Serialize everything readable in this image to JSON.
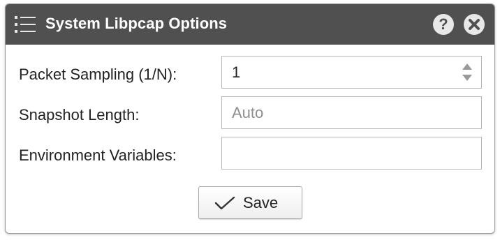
{
  "dialog": {
    "title": "System Libpcap Options",
    "title_icon": "list-icon",
    "help_icon": "help-icon",
    "close_icon": "close-icon",
    "help_glyph": "?"
  },
  "form": {
    "packet_sampling": {
      "label": "Packet Sampling (1/N):",
      "value": "1"
    },
    "snapshot_length": {
      "label": "Snapshot Length:",
      "value": "",
      "placeholder": "Auto"
    },
    "environment_variables": {
      "label": "Environment Variables:",
      "value": ""
    }
  },
  "actions": {
    "save_label": "Save",
    "save_icon": "checkmark-icon"
  },
  "colors": {
    "titlebar_bg": "#505050",
    "titlebar_text": "#ffffff",
    "placeholder_text": "#8f8f8f",
    "border": "#b9b9b9"
  }
}
